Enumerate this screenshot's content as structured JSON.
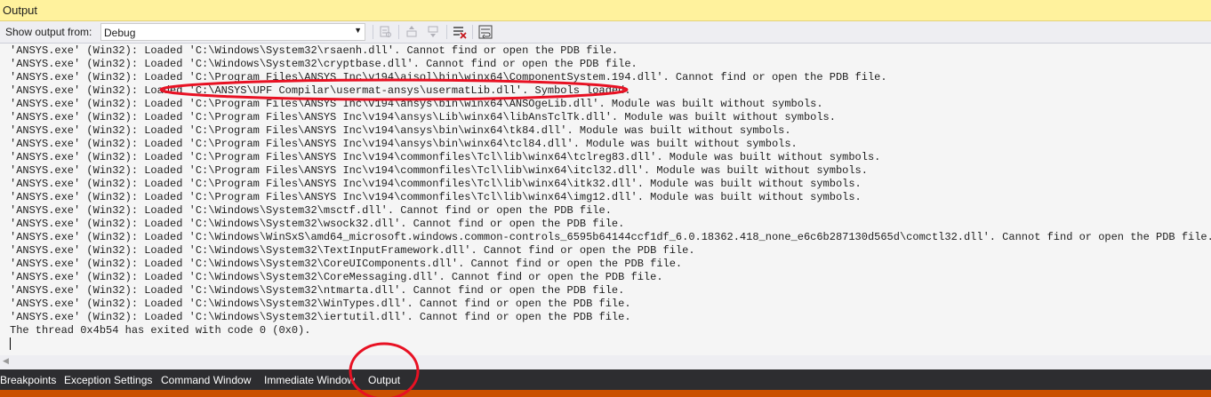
{
  "panel": {
    "title": "Output"
  },
  "toolbar": {
    "show_output_label": "Show output from:",
    "source_selected": "Debug"
  },
  "lines": [
    "'ANSYS.exe' (Win32): Loaded 'C:\\Windows\\System32\\rsaenh.dll'. Cannot find or open the PDB file.",
    "'ANSYS.exe' (Win32): Loaded 'C:\\Windows\\System32\\cryptbase.dll'. Cannot find or open the PDB file.",
    "'ANSYS.exe' (Win32): Loaded 'C:\\Program Files\\ANSYS Inc\\v194\\aisol\\bin\\winx64\\ComponentSystem.194.dll'. Cannot find or open the PDB file.",
    "'ANSYS.exe' (Win32): Loaded 'C:\\ANSYS\\UPF Compilar\\usermat-ansys\\usermatLib.dll'. Symbols loaded.",
    "'ANSYS.exe' (Win32): Loaded 'C:\\Program Files\\ANSYS Inc\\v194\\ansys\\bin\\winx64\\ANSOgeLib.dll'. Module was built without symbols.",
    "'ANSYS.exe' (Win32): Loaded 'C:\\Program Files\\ANSYS Inc\\v194\\ansys\\Lib\\winx64\\libAnsTclTk.dll'. Module was built without symbols.",
    "'ANSYS.exe' (Win32): Loaded 'C:\\Program Files\\ANSYS Inc\\v194\\ansys\\bin\\winx64\\tk84.dll'. Module was built without symbols.",
    "'ANSYS.exe' (Win32): Loaded 'C:\\Program Files\\ANSYS Inc\\v194\\ansys\\bin\\winx64\\tcl84.dll'. Module was built without symbols.",
    "'ANSYS.exe' (Win32): Loaded 'C:\\Program Files\\ANSYS Inc\\v194\\commonfiles\\Tcl\\lib\\winx64\\tclreg83.dll'. Module was built without symbols.",
    "'ANSYS.exe' (Win32): Loaded 'C:\\Program Files\\ANSYS Inc\\v194\\commonfiles\\Tcl\\lib\\winx64\\itcl32.dll'. Module was built without symbols.",
    "'ANSYS.exe' (Win32): Loaded 'C:\\Program Files\\ANSYS Inc\\v194\\commonfiles\\Tcl\\lib\\winx64\\itk32.dll'. Module was built without symbols.",
    "'ANSYS.exe' (Win32): Loaded 'C:\\Program Files\\ANSYS Inc\\v194\\commonfiles\\Tcl\\lib\\winx64\\img12.dll'. Module was built without symbols.",
    "'ANSYS.exe' (Win32): Loaded 'C:\\Windows\\System32\\msctf.dll'. Cannot find or open the PDB file.",
    "'ANSYS.exe' (Win32): Loaded 'C:\\Windows\\System32\\wsock32.dll'. Cannot find or open the PDB file.",
    "'ANSYS.exe' (Win32): Loaded 'C:\\Windows\\WinSxS\\amd64_microsoft.windows.common-controls_6595b64144ccf1df_6.0.18362.418_none_e6c6b287130d565d\\comctl32.dll'. Cannot find or open the PDB file.",
    "'ANSYS.exe' (Win32): Loaded 'C:\\Windows\\System32\\TextInputFramework.dll'. Cannot find or open the PDB file.",
    "'ANSYS.exe' (Win32): Loaded 'C:\\Windows\\System32\\CoreUIComponents.dll'. Cannot find or open the PDB file.",
    "'ANSYS.exe' (Win32): Loaded 'C:\\Windows\\System32\\CoreMessaging.dll'. Cannot find or open the PDB file.",
    "'ANSYS.exe' (Win32): Loaded 'C:\\Windows\\System32\\ntmarta.dll'. Cannot find or open the PDB file.",
    "'ANSYS.exe' (Win32): Loaded 'C:\\Windows\\System32\\WinTypes.dll'. Cannot find or open the PDB file.",
    "'ANSYS.exe' (Win32): Loaded 'C:\\Windows\\System32\\iertutil.dll'. Cannot find or open the PDB file.",
    "The thread 0x4b54 has exited with code 0 (0x0)."
  ],
  "tabs": [
    {
      "label": "Breakpoints"
    },
    {
      "label": "Exception Settings"
    },
    {
      "label": "Command Window"
    },
    {
      "label": "Immediate Window"
    },
    {
      "label": "Output"
    }
  ],
  "active_tab": "Output",
  "colors": {
    "title_bg": "#fff29d",
    "tabbar_bg": "#2d2d30",
    "status_orange": "#ca5100",
    "annotation_red": "#e81123"
  }
}
